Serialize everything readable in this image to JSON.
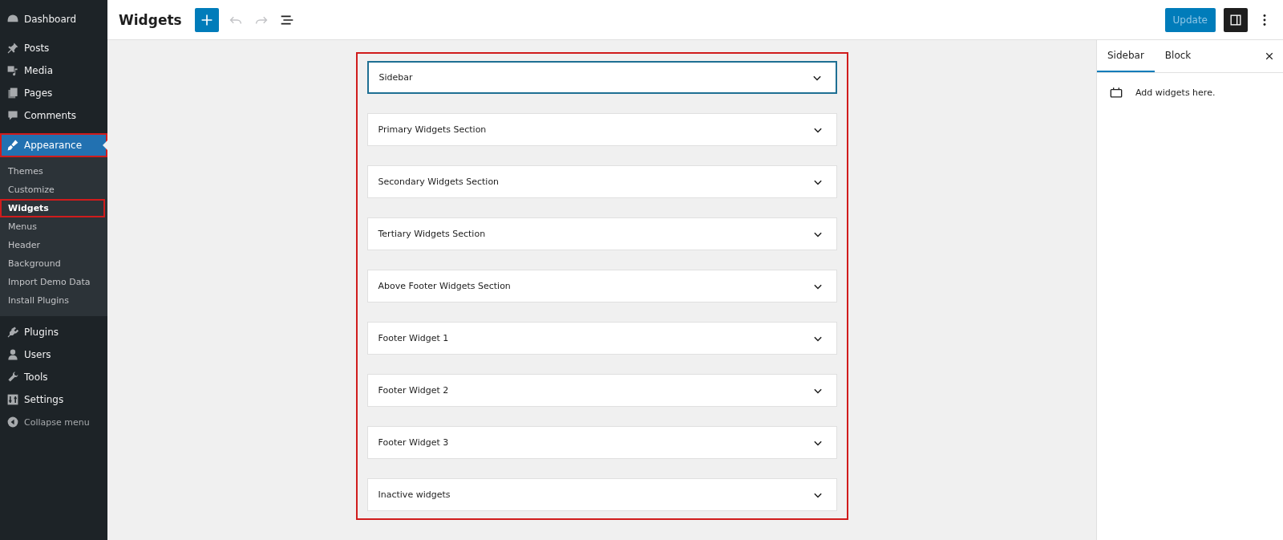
{
  "admin_menu": {
    "items": [
      {
        "label": "Dashboard",
        "selected": false,
        "highlighted": false
      },
      {
        "label": "Posts",
        "selected": false,
        "highlighted": false
      },
      {
        "label": "Media",
        "selected": false,
        "highlighted": false
      },
      {
        "label": "Pages",
        "selected": false,
        "highlighted": false
      },
      {
        "label": "Comments",
        "selected": false,
        "highlighted": false
      },
      {
        "label": "Appearance",
        "selected": true,
        "highlighted": true,
        "children": [
          {
            "label": "Themes",
            "selected": false,
            "highlighted": false
          },
          {
            "label": "Customize",
            "selected": false,
            "highlighted": false
          },
          {
            "label": "Widgets",
            "selected": true,
            "highlighted": true
          },
          {
            "label": "Menus",
            "selected": false,
            "highlighted": false
          },
          {
            "label": "Header",
            "selected": false,
            "highlighted": false
          },
          {
            "label": "Background",
            "selected": false,
            "highlighted": false
          },
          {
            "label": "Import Demo Data",
            "selected": false,
            "highlighted": false
          },
          {
            "label": "Install Plugins",
            "selected": false,
            "highlighted": false
          }
        ]
      },
      {
        "label": "Plugins",
        "selected": false,
        "highlighted": false
      },
      {
        "label": "Users",
        "selected": false,
        "highlighted": false
      },
      {
        "label": "Tools",
        "selected": false,
        "highlighted": false
      },
      {
        "label": "Settings",
        "selected": false,
        "highlighted": false
      }
    ],
    "collapse": "Collapse menu"
  },
  "header": {
    "title": "Widgets",
    "update_button": {
      "label": "Update",
      "disabled": true
    },
    "settings_toggle": {
      "on": true
    }
  },
  "widget_areas": {
    "highlighted": true,
    "items": [
      {
        "label": "Sidebar",
        "selected": true
      },
      {
        "label": "Primary Widgets Section",
        "selected": false
      },
      {
        "label": "Secondary Widgets Section",
        "selected": false
      },
      {
        "label": "Tertiary Widgets Section",
        "selected": false
      },
      {
        "label": "Above Footer Widgets Section",
        "selected": false
      },
      {
        "label": "Footer Widget 1",
        "selected": false
      },
      {
        "label": "Footer Widget 2",
        "selected": false
      },
      {
        "label": "Footer Widget 3",
        "selected": false
      },
      {
        "label": "Inactive widgets",
        "selected": false
      }
    ]
  },
  "settings_panel": {
    "tabs": [
      {
        "label": "Sidebar",
        "selected": true
      },
      {
        "label": "Block",
        "selected": false
      }
    ],
    "message": "Add widgets here."
  }
}
